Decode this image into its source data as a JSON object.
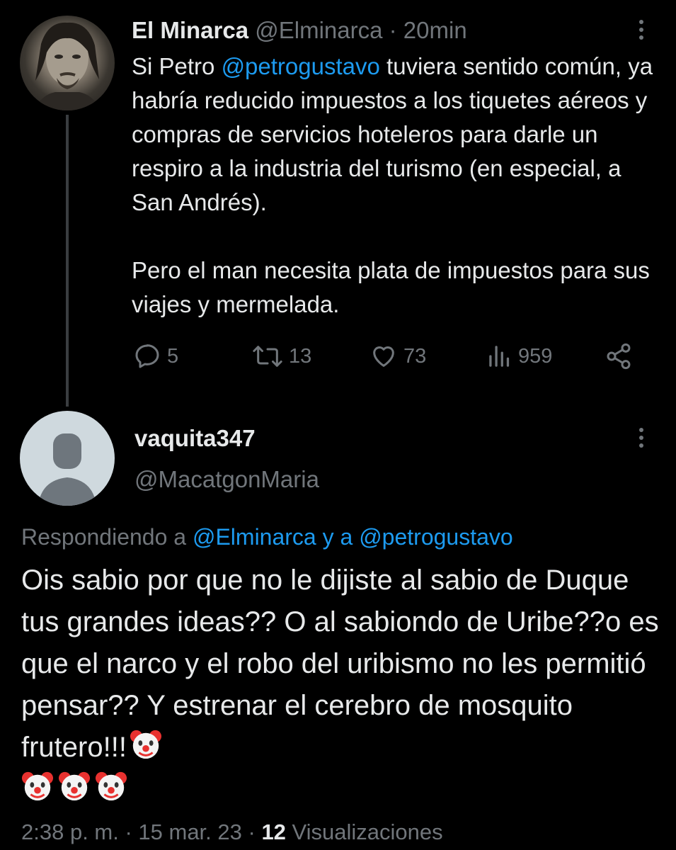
{
  "tweet": {
    "author_name": "El Minarca",
    "author_handle": "@Elminarca",
    "separator": " · ",
    "time": "20min",
    "line1_prefix": "Si Petro ",
    "line1_mention": "@petrogustavo",
    "line1_rest": " tuviera sentido común, ya habría reducido impuestos a los tiquetes aéreos y compras de servicios hoteleros para darle un respiro a la industria del turismo (en especial, a San Andrés).",
    "paragraph2": "Pero el man necesita plata de impuestos para sus viajes y mermelada.",
    "counts": {
      "replies": "5",
      "retweets": "13",
      "likes": "73",
      "views": "959"
    },
    "icons": [
      "avatar-portrait",
      "more-icon",
      "reply-icon",
      "retweet-icon",
      "like-icon",
      "views-icon",
      "share-icon"
    ]
  },
  "reply": {
    "author_name": "vaquita347",
    "author_handle": "@MacatgonMaria",
    "replying_prefix": "Respondiendo a ",
    "replying_mentions": "@Elminarca y a @petrogustavo",
    "text": "Ois sabio por que no le dijiste al sabio de Duque tus grandes ideas?? O al sabiondo de Uribe??o es que el narco y el robo del uribismo no les permitió pensar?? Y estrenar el cerebro de mosquito frutero!!!",
    "emoji": [
      "clown-face",
      "clown-face",
      "clown-face",
      "clown-face"
    ],
    "timestamp": "2:38 p. m. · 15 mar. 23 · ",
    "views_count": "12",
    "views_label": " Visualizaciones"
  },
  "colors": {
    "background": "#000000",
    "text": "#e7e9ea",
    "muted": "#71767b",
    "link": "#1d9bf0"
  }
}
